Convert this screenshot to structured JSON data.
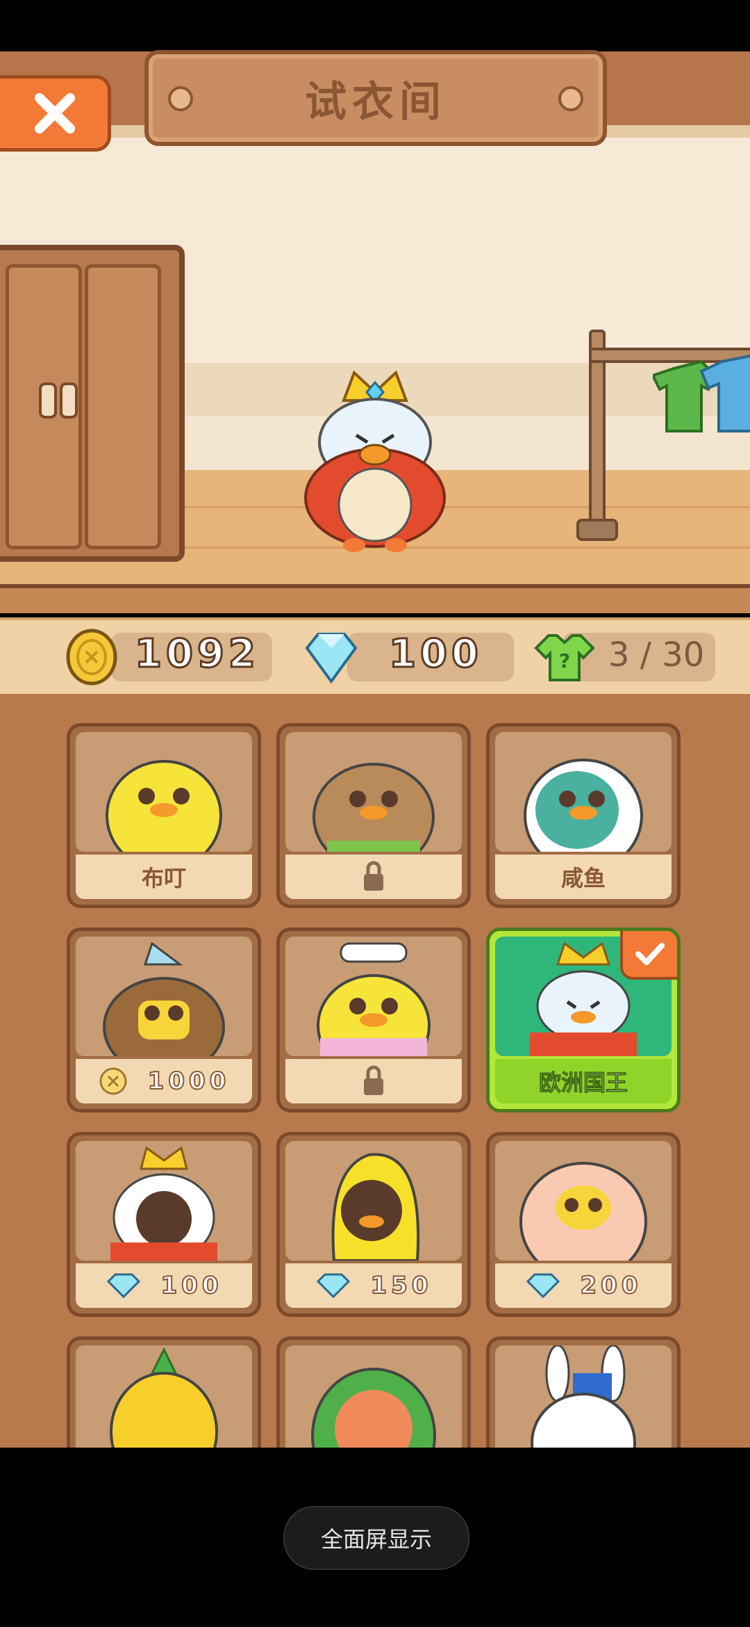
{
  "header": {
    "title": "试衣间"
  },
  "stats": {
    "coins": "1092",
    "diamonds": "100",
    "outfits": "3 / 30"
  },
  "outfits": [
    {
      "name": "布叮",
      "status": "owned"
    },
    {
      "name": "",
      "status": "locked"
    },
    {
      "name": "咸鱼",
      "status": "owned"
    },
    {
      "name": "",
      "status": "coin",
      "price": "1000"
    },
    {
      "name": "",
      "status": "locked"
    },
    {
      "name": "欧洲国王",
      "status": "selected"
    },
    {
      "name": "",
      "status": "diamond",
      "price": "100"
    },
    {
      "name": "",
      "status": "diamond",
      "price": "150"
    },
    {
      "name": "",
      "status": "diamond",
      "price": "200"
    },
    {
      "name": "",
      "status": "partial"
    },
    {
      "name": "",
      "status": "partial"
    },
    {
      "name": "",
      "status": "partial"
    }
  ],
  "system": {
    "fullscreen_label": "全面屏显示"
  },
  "colors": {
    "accent_orange": "#f37a36",
    "selected_green": "#90d42a",
    "wood": "#b8794d"
  }
}
